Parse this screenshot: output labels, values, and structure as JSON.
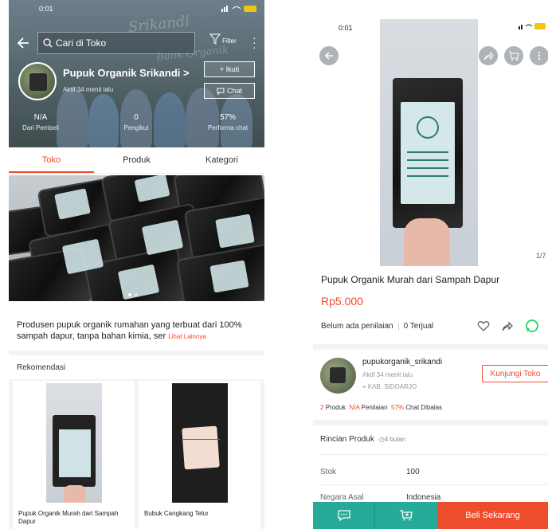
{
  "left": {
    "status_time": "0:01",
    "search_placeholder": "Cari di Toko",
    "filter_label": "Filter",
    "shop_name": "Pupuk Organik Srikandi",
    "shop_active": "Aktif 34 menit lalu",
    "follow_label": "+ Ikuti",
    "chat_label": "Chat",
    "stats": [
      {
        "value": "N/A",
        "label": "Dari Pembeli"
      },
      {
        "value": "0",
        "label": "Pengikut"
      },
      {
        "value": "57%",
        "label": "Performa chat"
      }
    ],
    "tabs": [
      "Toko",
      "Produk",
      "Kategori"
    ],
    "active_tab": "Toko",
    "description": "Produsen pupuk organik rumahan yang terbuat dari 100% sampah dapur, tanpa bahan kimia, ser",
    "more_link": "Lihat Lainnya",
    "reco_title": "Rekomendasi",
    "reco_items": [
      {
        "name": "Pupuk Organik  Murah dari Sampah Dapur"
      },
      {
        "name": "Bubuk Cangkang Telur"
      }
    ]
  },
  "right": {
    "status_time": "0:01",
    "pager": "1/7",
    "product_title": "Pupuk Organik  Murah dari Sampah Dapur",
    "price": "Rp5.000",
    "rating_text": "Belum ada penilaian",
    "sold_text": "0 Terjual",
    "seller_name": "pupukorganik_srikandi",
    "seller_active": "Aktif 34 menit lalu",
    "seller_location": "KAB. SIDOARJO",
    "visit_label": "Kunjungi Toko",
    "shop_stats": {
      "products_count": "2",
      "products_label": "Produk",
      "rating_value": "N/A",
      "rating_label": "Penilaian",
      "chat_value": "57%",
      "chat_label": "Chat Dibalas"
    },
    "spec_title": "Rincian Produk",
    "spec_time": "4 bulan",
    "specs": [
      {
        "key": "Stok",
        "value": "100"
      },
      {
        "key": "Negara Asal",
        "value": "Indonesia"
      }
    ],
    "buy_label": "Beli Sekarang"
  },
  "colors": {
    "accent": "#ee4d2d",
    "teal": "#26aa99"
  }
}
